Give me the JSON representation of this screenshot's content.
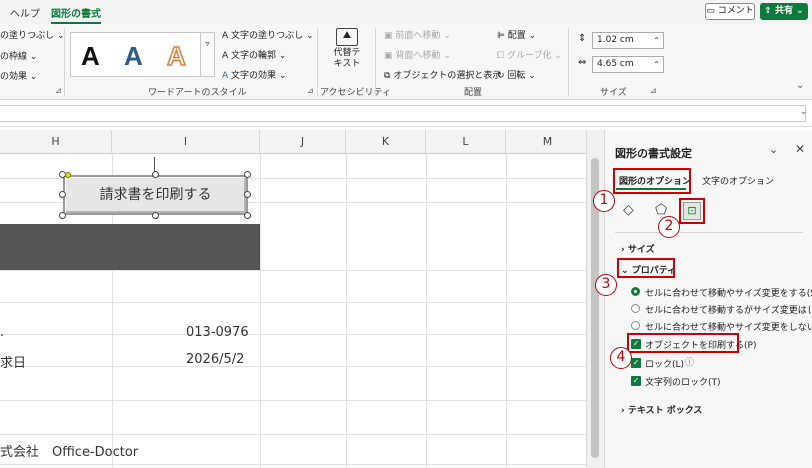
{
  "tabs": {
    "help": "ヘルプ",
    "shape_format": "図形の書式"
  },
  "top_buttons": {
    "comment": "コメント",
    "share": "共有"
  },
  "ribbon": {
    "fill": "の塗りつぶし",
    "outline": "の枠線",
    "effects": "の効果",
    "wordart_letter": "A",
    "text_fill": "文字の塗りつぶし",
    "text_outline": "文字の輪郭",
    "text_effects": "文字の効果",
    "wordart_group": "ワードアートのスタイル",
    "alt_text": "代替テキスト",
    "accessibility_group": "アクセシビリティ",
    "bring_forward": "前面へ移動",
    "send_backward": "背面へ移動",
    "selection_pane": "オブジェクトの選択と表示",
    "align": "配置",
    "group": "グループ化",
    "rotate": "回転",
    "arrange_group": "配置",
    "height": "1.02 cm",
    "width": "4.65 cm",
    "size_group": "サイズ"
  },
  "sheet": {
    "columns": [
      "H",
      "I",
      "J",
      "K",
      "L",
      "M"
    ],
    "shape_label": "請求書を印刷する",
    "cells": {
      "dot": ".",
      "postal": "013-0976",
      "request_date_label": "求日",
      "request_date": "2026/5/2",
      "company": "式会社　Office-Doctor"
    }
  },
  "pane": {
    "title": "図形の書式設定",
    "tab_shape_options": "図形のオプション",
    "tab_text_options": "文字のオプション",
    "size_section": "サイズ",
    "properties_section": "プロパティ",
    "radio_move_size": "セルに合わせて移動やサイズ変更をする(S)",
    "radio_move_only": "セルに合わせて移動するがサイズ変更はしない",
    "radio_none": "セルに合わせて移動やサイズ変更をしない(D)",
    "print_object": "オブジェクトを印刷する(P)",
    "lock": "ロック(L)",
    "lock_text": "文字列のロック(T)",
    "textbox_section": "テキスト ボックス",
    "markers": [
      "1",
      "2",
      "3",
      "4"
    ]
  },
  "colors": {
    "accent": "#0e7a3b",
    "highlight": "#d00000"
  }
}
